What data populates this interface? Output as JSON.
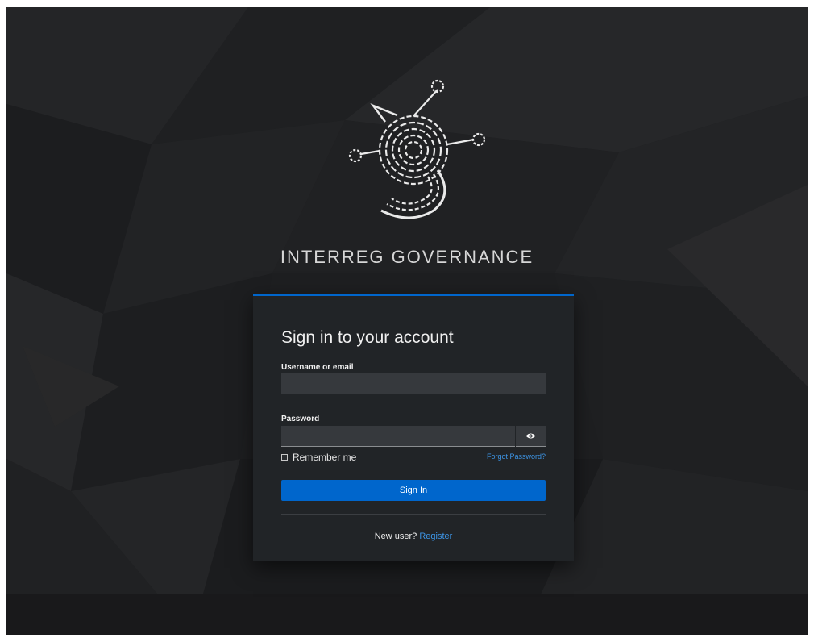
{
  "brand": {
    "name": "INTERREG GOVERNANCE"
  },
  "login": {
    "title": "Sign in to your account",
    "username_label": "Username or email",
    "username_value": "",
    "password_label": "Password",
    "password_value": "",
    "remember_label": "Remember me",
    "remember_checked": false,
    "forgot_label": "Forgot Password?",
    "submit_label": "Sign In",
    "new_user_text": "New user?",
    "register_label": "Register"
  },
  "icons": {
    "password_toggle": "eye-icon",
    "logo": "logo-icon"
  },
  "colors": {
    "accent": "#0066cc",
    "link": "#3d95e6",
    "card_bg": "#212427",
    "page_bg": "#1e1f21"
  }
}
